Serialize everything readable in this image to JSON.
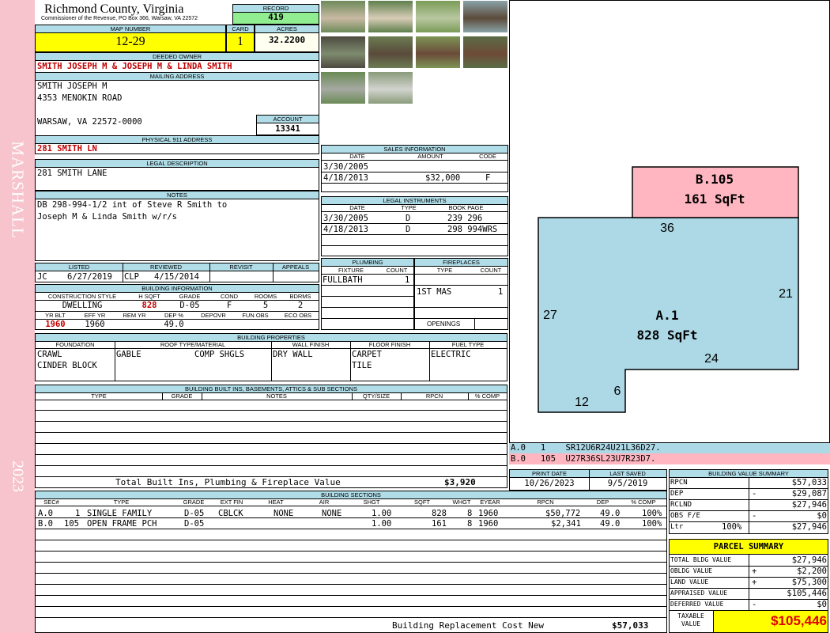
{
  "sidebar": {
    "neighborhood": "MARSHALL",
    "year": "2023",
    "bg": "#f7c3cc"
  },
  "header": {
    "county": "Richmond County, Virginia",
    "address": "Commissioner of the Revenue, PO Box 366, Warsaw, VA 22572",
    "record_label": "RECORD",
    "record": "419",
    "map_label": "MAP NUMBER",
    "map": "12-29",
    "card_label": "CARD",
    "card": "1",
    "acres_label": "ACRES",
    "acres": "32.2200"
  },
  "owner": {
    "label": "DEEDED OWNER",
    "name": "SMITH JOSEPH M & JOSEPH M & LINDA SMITH",
    "mail_label": "MAILING ADDRESS",
    "mail_line1": "SMITH JOSEPH M",
    "mail_line2": "4353 MENOKIN ROAD",
    "mail_line3": "WARSAW, VA 22572-0000",
    "account_label": "ACCOUNT",
    "account": "13341"
  },
  "physical": {
    "label": "PHYSICAL 911 ADDRESS",
    "value": "281 SMITH LN"
  },
  "legal": {
    "label": "LEGAL DESCRIPTION",
    "value": "281 SMITH LANE"
  },
  "notes": {
    "label": "NOTES",
    "line1": "DB 298-994-1/2 int of Steve R Smith to",
    "line2": "Joseph M & Linda Smith w/r/s"
  },
  "sales": {
    "label": "SALES INFORMATION",
    "cols": [
      "DATE",
      "AMOUNT",
      "CODE"
    ],
    "rows": [
      {
        "date": "3/30/2005",
        "amount": "",
        "code": ""
      },
      {
        "date": "4/18/2013",
        "amount": "$32,000",
        "code": "F"
      }
    ]
  },
  "instruments": {
    "label": "LEGAL INSTRUMENTS",
    "cols": [
      "DATE",
      "TYPE",
      "BOOK PAGE"
    ],
    "rows": [
      {
        "date": "3/30/2005",
        "type": "D",
        "book": "239 296"
      },
      {
        "date": "4/18/2013",
        "type": "D",
        "book": "298 994WRS"
      }
    ]
  },
  "review": {
    "cols": [
      "LISTED",
      "REVIEWED",
      "REVISIT",
      "APPEALS"
    ],
    "listed_by": "JC",
    "listed_date": "6/27/2019",
    "reviewed_by": "CLP",
    "reviewed_date": "4/15/2014"
  },
  "plumbing": {
    "label": "PLUMBING",
    "cols": [
      "FIXTURE",
      "COUNT"
    ],
    "fixture": "FULLBATH",
    "count": "1"
  },
  "fireplaces": {
    "label": "FIREPLACES",
    "cols": [
      "TYPE",
      "COUNT"
    ],
    "type": "1ST MAS",
    "count": "1",
    "openings_label": "OPENINGS"
  },
  "building": {
    "label": "BUILDING INFORMATION",
    "cols": [
      "CONSTRUCTION STYLE",
      "H SQFT",
      "GRADE",
      "COND",
      "ROOMS",
      "BDRMS"
    ],
    "style": "DWELLING",
    "hsqft": "828",
    "grade": "D-05",
    "cond": "F",
    "rooms": "5",
    "bdrms": "2",
    "cols2": [
      "YR BLT",
      "EFF YR",
      "REM YR",
      "DEP %",
      "DEPOVR",
      "FUN OBS",
      "ECO OBS"
    ],
    "yrblt": "1960",
    "effyr": "1960",
    "dep": "49.0"
  },
  "properties": {
    "label": "BUILDING PROPERTIES",
    "cols": [
      "FOUNDATION",
      "ROOF TYPE/MATERIAL",
      "WALL FINISH",
      "FLOOR FINISH",
      "FUEL TYPE"
    ],
    "foundation1": "CRAWL",
    "foundation2": "CINDER BLOCK",
    "roof_type": "GABLE",
    "roof_mat": "COMP SHGLS",
    "wall": "DRY WALL",
    "floor1": "CARPET",
    "floor2": "TILE",
    "fuel": "ELECTRIC"
  },
  "builtins": {
    "label": "BUILDING BUILT INS, BASEMENTS, ATTICS & SUB SECTIONS",
    "cols": [
      "TYPE",
      "GRADE",
      "NOTES",
      "QTY/SIZE",
      "RPCN",
      "% COMP"
    ],
    "total_label": "Total Built Ins, Plumbing & Fireplace Value",
    "total": "$3,920"
  },
  "dates": {
    "print_label": "PRINT DATE",
    "print": "10/26/2023",
    "saved_label": "LAST SAVED",
    "saved": "9/5/2019"
  },
  "sections": {
    "label": "BUILDING SECTIONS",
    "cols": [
      "SEC#",
      "TYPE",
      "GRADE",
      "EXT FIN",
      "HEAT",
      "AIR",
      "SHGT",
      "SQFT",
      "WHGT",
      "EYEAR",
      "RPCN",
      "DEP",
      "% COMP"
    ],
    "rows": [
      {
        "sec": "A.0",
        "num": "1",
        "type": "SINGLE FAMILY",
        "grade": "D-05",
        "ext": "CBLCK",
        "heat": "NONE",
        "air": "NONE",
        "shgt": "1.00",
        "sqft": "828",
        "whgt": "8",
        "eyear": "1960",
        "rpcn": "$50,772",
        "dep": "49.0",
        "comp": "100%"
      },
      {
        "sec": "B.0",
        "num": "105",
        "type": "OPEN FRAME PCH",
        "grade": "D-05",
        "ext": "",
        "heat": "",
        "air": "",
        "shgt": "1.00",
        "sqft": "161",
        "whgt": "8",
        "eyear": "1960",
        "rpcn": "$2,341",
        "dep": "49.0",
        "comp": "100%"
      }
    ],
    "replacement_label": "Building Replacement Cost New",
    "replacement": "$57,033"
  },
  "sketch": {
    "a_label": "A.1",
    "a_sqft": "828 SqFt",
    "b_label": "B.105",
    "b_sqft": "161 SqFt",
    "d36": "36",
    "d21": "21",
    "d27": "27",
    "d24": "24",
    "d6": "6",
    "d12": "12",
    "line_a": "A.0   1    SR12U6R24U21L36D27.",
    "line_b": "B.0   105  U27R36SL23U7R23D7.",
    "a_color": "#add8e6",
    "b_color": "#ffb6c1"
  },
  "value_summary": {
    "label": "BUILDING VALUE SUMMARY",
    "rpcn_label": "RPCN",
    "rpcn": "$57,033",
    "dep_label": "DEP",
    "dep_sign": "-",
    "dep": "$29,087",
    "rclnd_label": "RCLND",
    "rclnd": "$27,946",
    "obs_label": "OBS F/E",
    "obs_sign": "-",
    "obs": "$0",
    "ltr_label": "Ltr",
    "ltr_pct": "100%",
    "ltr": "$27,946"
  },
  "parcel": {
    "label": "PARCEL SUMMARY",
    "bldg_label": "TOTAL BLDG VALUE",
    "bldg": "$27,946",
    "obldg_label": "OBLDG VALUE",
    "obldg_sign": "+",
    "obldg": "$2,200",
    "land_label": "LAND VALUE",
    "land_sign": "+",
    "land": "$75,300",
    "appraised_label": "APPRAISED VALUE",
    "appraised": "$105,446",
    "deferred_label": "DEFERRED VALUE",
    "deferred_sign": "-",
    "deferred": "$0",
    "taxable_label1": "TAXABLE",
    "taxable_label2": "VALUE",
    "taxable": "$105,446"
  },
  "photos": [
    {
      "name": "house-front",
      "c1": "#6d8a5a",
      "c2": "#c9b9a3"
    },
    {
      "name": "house-side",
      "c1": "#5e7f4a",
      "c2": "#d8cdb8"
    },
    {
      "name": "yard",
      "c1": "#7a9c57",
      "c2": "#b9c7a0"
    },
    {
      "name": "barn",
      "c1": "#8aa3a8",
      "c2": "#5c4a3a"
    },
    {
      "name": "shed-1",
      "c1": "#4d4a40",
      "c2": "#7e8b6d"
    },
    {
      "name": "shed-2",
      "c1": "#6b7c52",
      "c2": "#5a4a3b"
    },
    {
      "name": "shed-3",
      "c1": "#7d9555",
      "c2": "#6b4a3a"
    },
    {
      "name": "shed-4",
      "c1": "#5a6d45",
      "c2": "#6e4a37"
    },
    {
      "name": "house-rear",
      "c1": "#6a8a55",
      "c2": "#a6a9a2"
    },
    {
      "name": "carport",
      "c1": "#8a9b7a",
      "c2": "#d2d4cf"
    }
  ]
}
